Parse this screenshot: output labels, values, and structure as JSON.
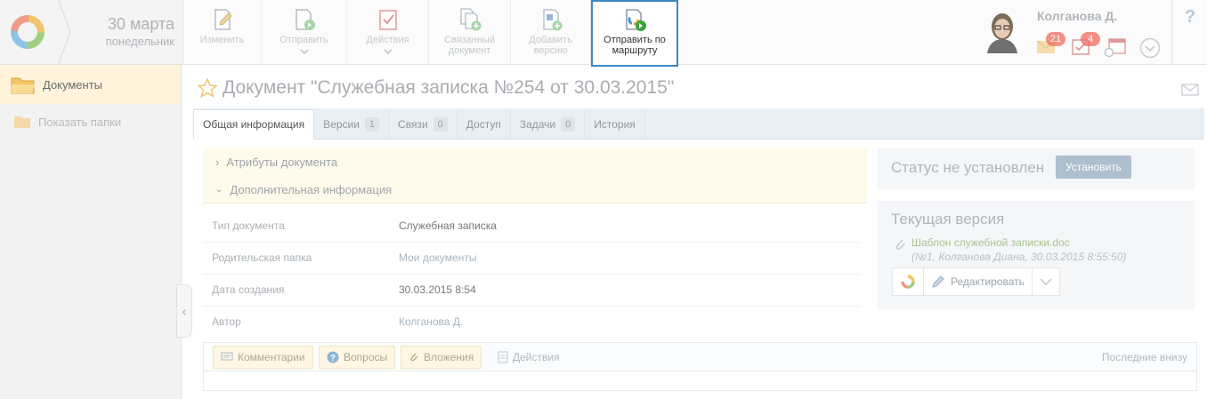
{
  "header": {
    "date_day": "30 марта",
    "date_weekday": "понедельник"
  },
  "toolbar": {
    "edit": "Изменить",
    "send": "Отправить",
    "actions": "Действия",
    "linked_doc": "Связанный документ",
    "add_version": "Добавить версию",
    "send_route": "Отправить по маршруту"
  },
  "user": {
    "name": "Колганова Д.",
    "mail_count": "21",
    "tasks_count": "4"
  },
  "help": "?",
  "sidebar": {
    "documents": "Документы",
    "show_folders": "Показать папки"
  },
  "document": {
    "title": "Документ \"Служебная записка №254 от 30.03.2015\""
  },
  "tabs": [
    {
      "label": "Общая информация",
      "count": ""
    },
    {
      "label": "Версии",
      "count": "1"
    },
    {
      "label": "Связи",
      "count": "0"
    },
    {
      "label": "Доступ",
      "count": ""
    },
    {
      "label": "Задачи",
      "count": "0"
    },
    {
      "label": "История",
      "count": ""
    }
  ],
  "sections": {
    "attributes": "Атрибуты документа",
    "extra": "Дополнительная информация"
  },
  "fields": [
    {
      "label": "Тип документа",
      "value": "Служебная записка"
    },
    {
      "label": "Родительская папка",
      "value": "Мои документы"
    },
    {
      "label": "Дата создания",
      "value": "30.03.2015 8:54"
    },
    {
      "label": "Автор",
      "value": "Колганова Д."
    }
  ],
  "comments_bar": {
    "comments": "Комментарии",
    "questions": "Вопросы",
    "attachments": "Вложения",
    "actions": "Действия",
    "sort_hint": "Последние внизу"
  },
  "status": {
    "text": "Статус не установлен",
    "button": "Установить"
  },
  "version": {
    "title": "Текущая версия",
    "file_name": "Шаблон служебной записки.doc",
    "file_meta": "(№1, Колганова Диана, 30.03.2015 8:55:50)",
    "edit": "Редактировать"
  },
  "colors": {
    "accent": "#3d86c2",
    "highlight": "#fff3dc",
    "badge": "#f06b60"
  }
}
